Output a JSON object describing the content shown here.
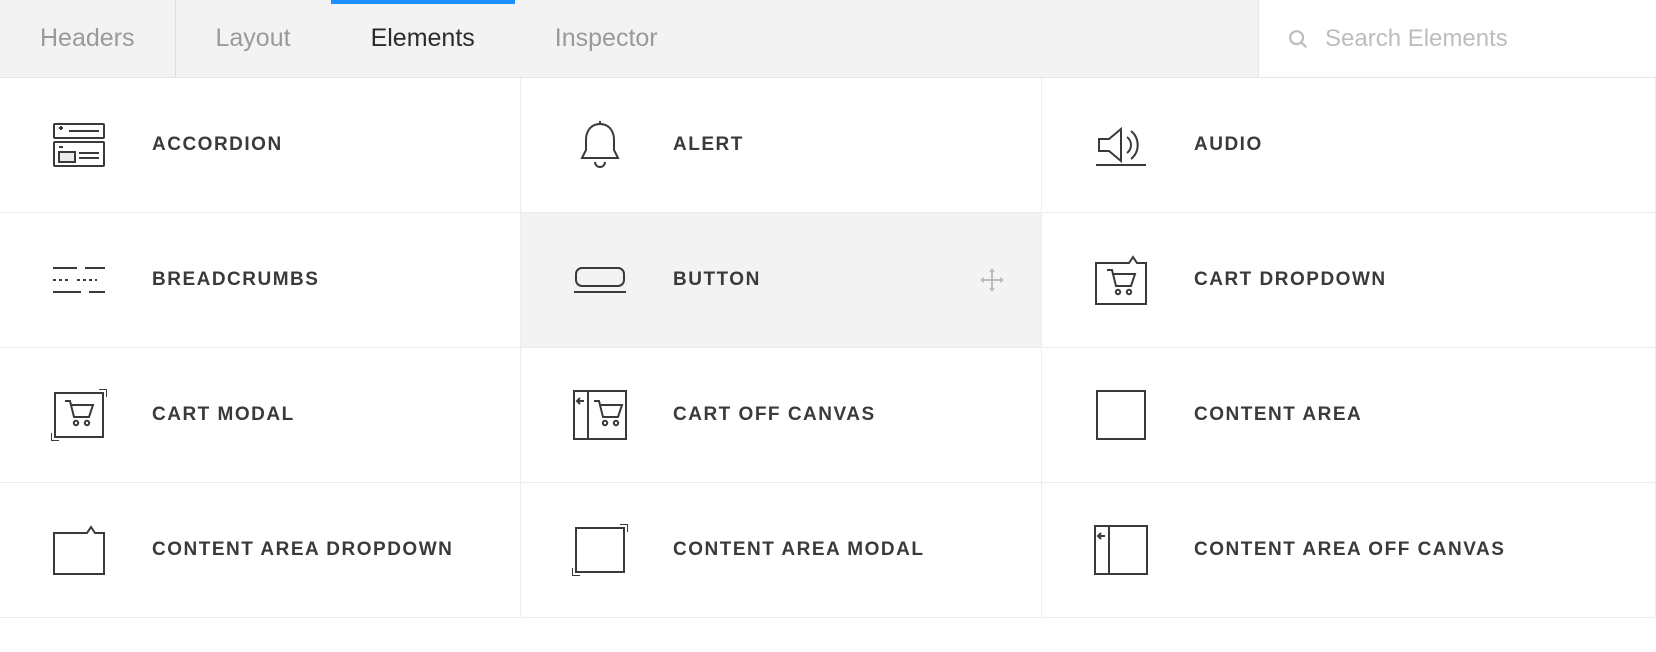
{
  "tabs": {
    "headers": "Headers",
    "layout": "Layout",
    "elements": "Elements",
    "inspector": "Inspector",
    "active": "elements"
  },
  "search": {
    "placeholder": "Search Elements",
    "value": ""
  },
  "elements": [
    {
      "id": "accordion",
      "label": "ACCORDION"
    },
    {
      "id": "alert",
      "label": "ALERT"
    },
    {
      "id": "audio",
      "label": "AUDIO"
    },
    {
      "id": "breadcrumbs",
      "label": "BREADCRUMBS"
    },
    {
      "id": "button",
      "label": "BUTTON",
      "hovered": true
    },
    {
      "id": "cart-dropdown",
      "label": "CART DROPDOWN"
    },
    {
      "id": "cart-modal",
      "label": "CART MODAL"
    },
    {
      "id": "cart-off-canvas",
      "label": "CART OFF CANVAS"
    },
    {
      "id": "content-area",
      "label": "CONTENT AREA"
    },
    {
      "id": "content-area-dropdown",
      "label": "CONTENT AREA DROPDOWN"
    },
    {
      "id": "content-area-modal",
      "label": "CONTENT AREA MODAL"
    },
    {
      "id": "content-area-off-canvas",
      "label": "CONTENT AREA OFF CANVAS"
    }
  ]
}
